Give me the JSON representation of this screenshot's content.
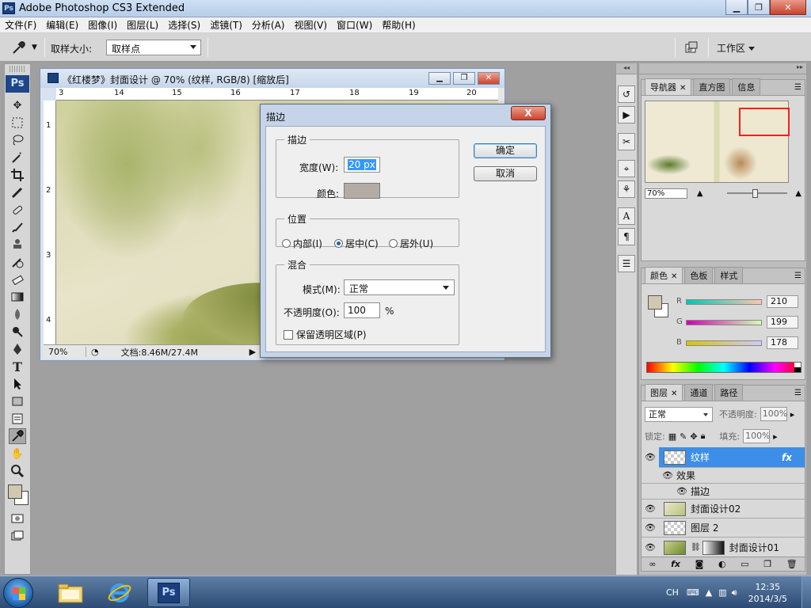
{
  "app": {
    "title": "Adobe Photoshop CS3 Extended",
    "ps_logo": "Ps"
  },
  "menu": [
    "文件(F)",
    "编辑(E)",
    "图像(I)",
    "图层(L)",
    "选择(S)",
    "滤镜(T)",
    "分析(A)",
    "视图(V)",
    "窗口(W)",
    "帮助(H)"
  ],
  "options_bar": {
    "sample_size_label": "取样大小:",
    "sample_size_value": "取样点",
    "workspace_label": "工作区"
  },
  "document": {
    "title": "《红楼梦》封面设计 @ 70% (纹样, RGB/8) [缩放后]",
    "ruler_top": [
      "3",
      "14",
      "15",
      "16",
      "17",
      "18",
      "19",
      "20"
    ],
    "ruler_left": [
      "1",
      "2",
      "3",
      "4"
    ],
    "zoom": "70%",
    "doc_info": "文档:8.46M/27.4M"
  },
  "dialog": {
    "title": "描边",
    "close": "X",
    "stroke_group": "描边",
    "width_label": "宽度(W):",
    "width_value": "20 px",
    "color_label": "颜色:",
    "color_value": "#b2aca4",
    "location_group": "位置",
    "loc_inside": "内部(I)",
    "loc_center": "居中(C)",
    "loc_outside": "居外(U)",
    "loc_selected": "center",
    "blend_group": "混合",
    "mode_label": "模式(M):",
    "mode_value": "正常",
    "opacity_label": "不透明度(O):",
    "opacity_value": "100",
    "opacity_unit": "%",
    "preserve_label": "保留透明区域(P)",
    "ok": "确定",
    "cancel": "取消"
  },
  "navigator_panel": {
    "tabs": [
      "导航器",
      "直方图",
      "信息"
    ],
    "zoom": "70%"
  },
  "color_panel": {
    "tabs": [
      "颜色",
      "色板",
      "样式"
    ],
    "channels": [
      {
        "name": "R",
        "value": "210"
      },
      {
        "name": "G",
        "value": "199"
      },
      {
        "name": "B",
        "value": "178"
      }
    ],
    "foreground": "#d2c7b2"
  },
  "layers_panel": {
    "tabs": [
      "图层",
      "通道",
      "路径"
    ],
    "blend_mode": "正常",
    "opacity_label": "不透明度:",
    "opacity_value": "100%",
    "lock_label": "锁定:",
    "fill_label": "填充:",
    "fill_value": "100%",
    "layers": [
      {
        "name": "纹样",
        "selected": true,
        "fx": "fx"
      },
      {
        "name": "效果",
        "type": "effects"
      },
      {
        "name": "描边",
        "type": "effect"
      },
      {
        "name": "封面设计02"
      },
      {
        "name": "图层 2"
      },
      {
        "name": "封面设计01"
      }
    ]
  },
  "taskbar": {
    "lang": "CH",
    "time": "12:35",
    "date": "2014/3/5"
  }
}
